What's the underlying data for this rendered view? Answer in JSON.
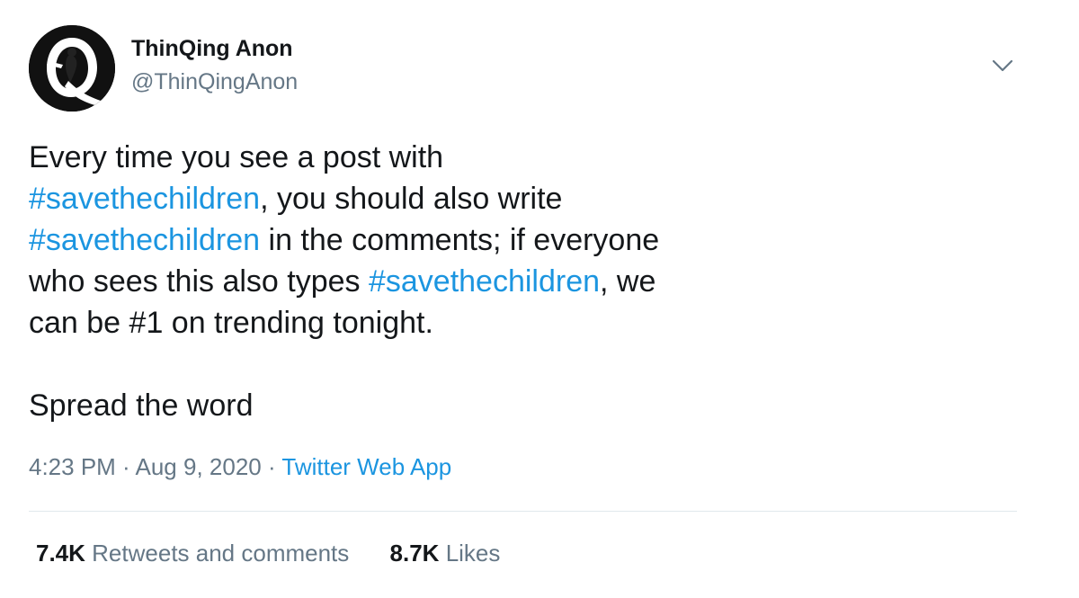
{
  "author": {
    "name": "ThinQing Anon",
    "handle": "@ThinQingAnon",
    "avatar_letter": "Q"
  },
  "tweet": {
    "lines": [
      [
        {
          "text": "Every time you see a post with",
          "type": "text"
        }
      ],
      [
        {
          "text": "#savethechildren",
          "type": "hashtag"
        },
        {
          "text": ", you should also write",
          "type": "text"
        }
      ],
      [
        {
          "text": "#savethechildren",
          "type": "hashtag"
        },
        {
          "text": " in the comments; if everyone",
          "type": "text"
        }
      ],
      [
        {
          "text": "who sees this also types ",
          "type": "text"
        },
        {
          "text": "#savethechildren",
          "type": "hashtag"
        },
        {
          "text": ", we",
          "type": "text"
        }
      ],
      [
        {
          "text": "can be #1 on trending tonight.",
          "type": "text"
        }
      ],
      [],
      [
        {
          "text": "Spread the word",
          "type": "text"
        }
      ]
    ]
  },
  "meta": {
    "time": "4:23 PM",
    "separator": " · ",
    "date": "Aug 9, 2020",
    "source": "Twitter Web App"
  },
  "stats": {
    "retweets_count": "7.4K",
    "retweets_label": "Retweets and comments",
    "likes_count": "8.7K",
    "likes_label": "Likes"
  },
  "icons": {
    "caret": "chevron-down-icon"
  },
  "colors": {
    "text": "#14171a",
    "secondary": "#657786",
    "link": "#1b95e0",
    "divider": "#e1e8ed"
  }
}
